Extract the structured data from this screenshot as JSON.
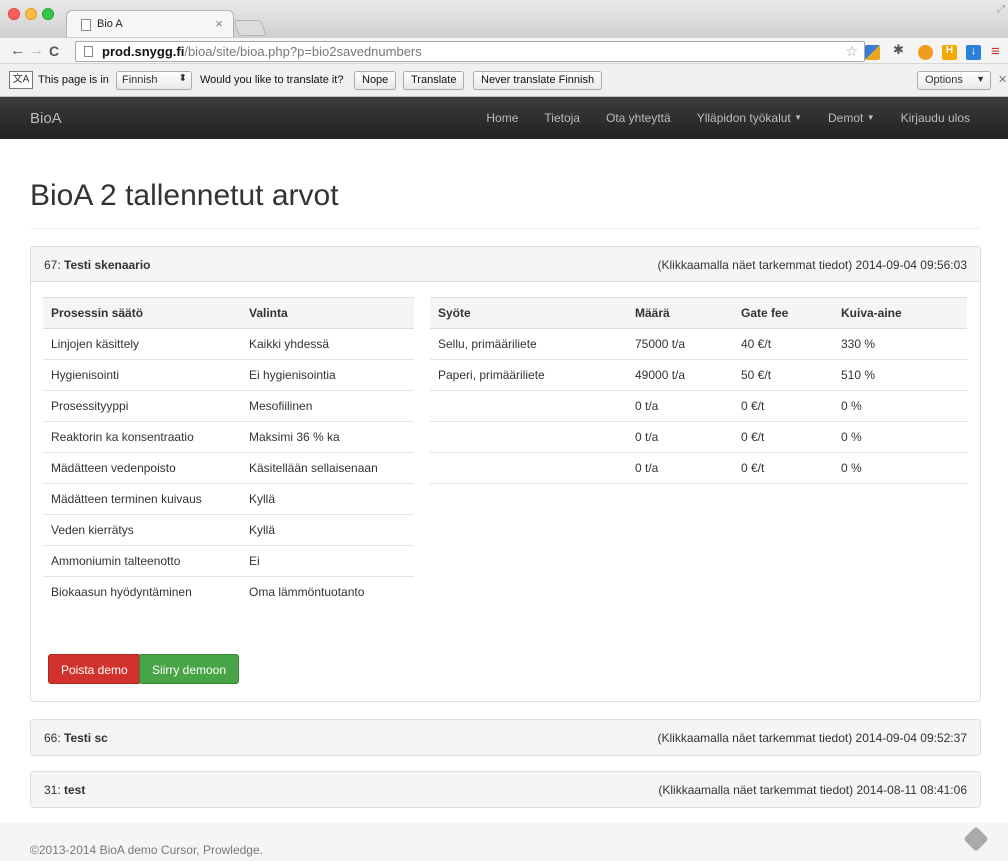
{
  "browser": {
    "tab_title": "Bio A",
    "tab_close": "×",
    "url_domain": "prod.snygg.fi",
    "url_path": "/bioa/site/bioa.php?p=bio2savednumbers",
    "translate": {
      "text_page_is_in": "This page is in",
      "language": "Finnish",
      "question": "Would you like to translate it?",
      "nope": "Nope",
      "translate": "Translate",
      "never": "Never translate Finnish",
      "options": "Options"
    }
  },
  "navbar": {
    "brand": "BioA",
    "links": [
      "Home",
      "Tietoja",
      "Ota yhteyttä",
      "Ylläpidon työkalut",
      "Demot",
      "Kirjaudu ulos"
    ]
  },
  "page": {
    "title": "BioA 2 tallennetut arvot"
  },
  "panels": [
    {
      "id": "67: ",
      "name": "Testi skenaario",
      "info": "(Klikkaamalla näet tarkemmat tiedot) 2014-09-04 09:56:03"
    },
    {
      "id": "66: ",
      "name": "Testi sc",
      "info": "(Klikkaamalla näet tarkemmat tiedot) 2014-09-04 09:52:37"
    },
    {
      "id": "31: ",
      "name": "test",
      "info": "(Klikkaamalla näet tarkemmat tiedot) 2014-08-11 08:41:06"
    }
  ],
  "process_table": {
    "headers": [
      "Prosessin säätö",
      "Valinta"
    ],
    "rows": [
      [
        "Linjojen käsittely",
        "Kaikki yhdessä"
      ],
      [
        "Hygienisointi",
        "Ei hygienisointia"
      ],
      [
        "Prosessityyppi",
        "Mesofiilinen"
      ],
      [
        "Reaktorin ka konsentraatio",
        "Maksimi 36 % ka"
      ],
      [
        "Mädätteen vedenpoisto",
        "Käsitellään sellaisenaan"
      ],
      [
        "Mädätteen terminen kuivaus",
        "Kyllä"
      ],
      [
        "Veden kierrätys",
        "Kyllä"
      ],
      [
        "Ammoniumin talteenotto",
        "Ei"
      ],
      [
        "Biokaasun hyödyntäminen",
        "Oma lämmöntuotanto"
      ]
    ]
  },
  "input_table": {
    "headers": [
      "Syöte",
      "Määrä",
      "Gate fee",
      "Kuiva-aine"
    ],
    "rows": [
      [
        "Sellu, primääriliete",
        "75000 t/a",
        "40 €/t",
        "330 %"
      ],
      [
        "Paperi, primääriliete",
        "49000 t/a",
        "50 €/t",
        "510 %"
      ],
      [
        "",
        "0 t/a",
        "0 €/t",
        "0 %"
      ],
      [
        "",
        "0 t/a",
        "0 €/t",
        "0 %"
      ],
      [
        "",
        "0 t/a",
        "0 €/t",
        "0 %"
      ]
    ]
  },
  "buttons": {
    "delete": "Poista demo",
    "goto": "Siirry demoon"
  },
  "footer": {
    "text": "©2013-2014 BioA demo Cursor, Prowledge."
  }
}
